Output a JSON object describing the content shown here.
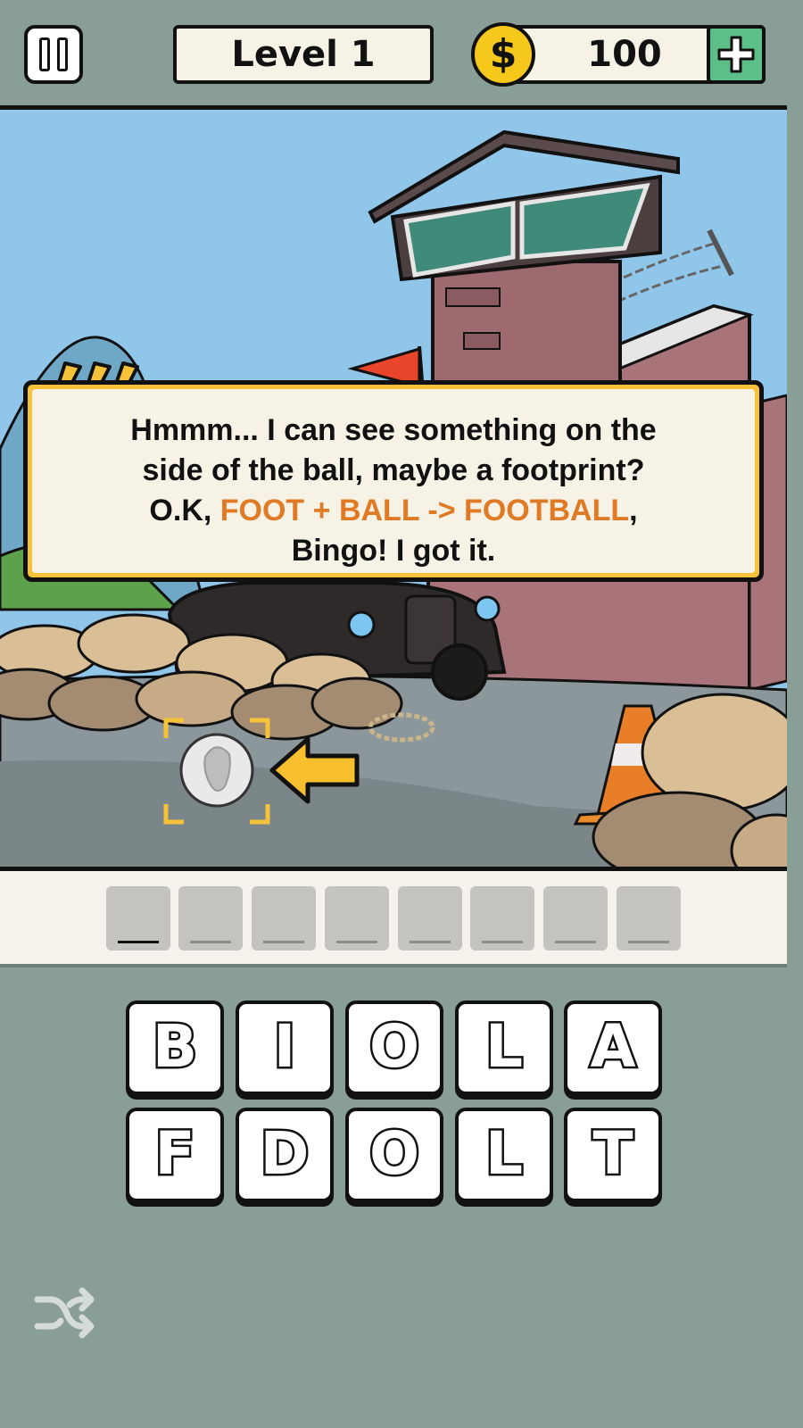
{
  "header": {
    "level_label": "Level 1",
    "coins": "100",
    "coin_symbol": "$"
  },
  "hint": {
    "line1": "Hmmm... I can see something on the",
    "line2": "side of the ball, maybe a footprint?",
    "line3_prefix": "O.K, ",
    "line3_highlight": "FOOT + BALL -> FOOTBALL",
    "line3_suffix": ",",
    "line4": "Bingo! I got it."
  },
  "answer_slots": [
    "",
    "",
    "",
    "",
    "",
    "",
    "",
    ""
  ],
  "letters_row1": [
    "B",
    "I",
    "O",
    "L",
    "A"
  ],
  "letters_row2": [
    "F",
    "D",
    "O",
    "L",
    "T"
  ],
  "colors": {
    "background": "#8a9e98",
    "highlight": "#e07a24",
    "coin": "#f5c81b",
    "plus": "#5cbf87",
    "arrow": "#f7be2e"
  }
}
